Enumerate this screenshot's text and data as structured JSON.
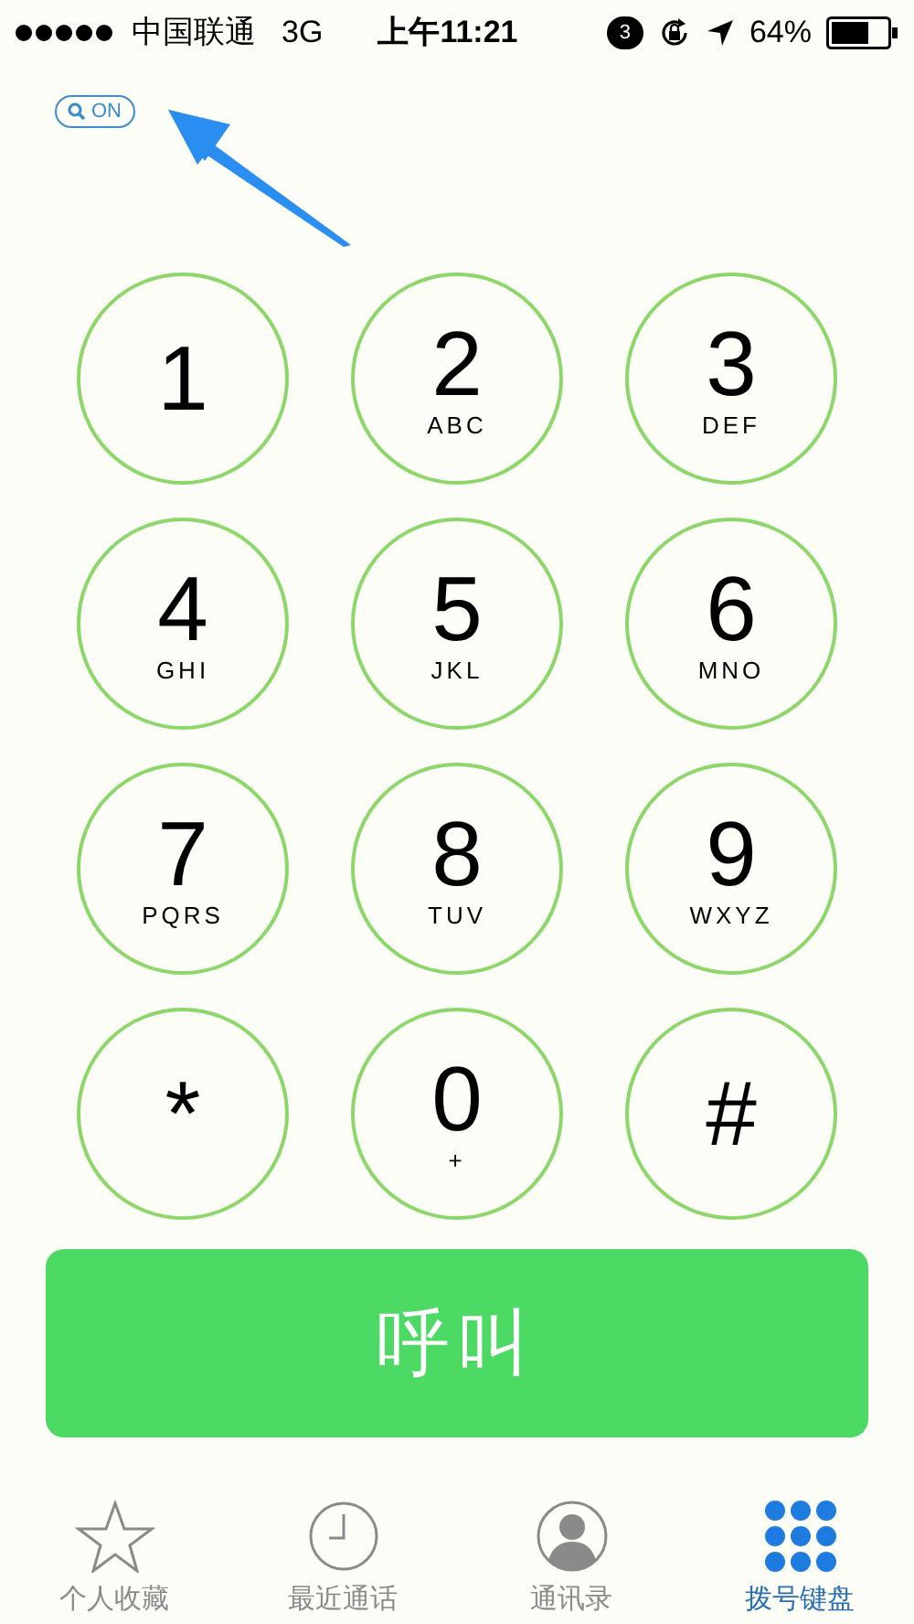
{
  "status_bar": {
    "carrier": "中国联通",
    "network": "3G",
    "time": "上午11:21",
    "notification_count": "3",
    "battery": "64%"
  },
  "search_badge": {
    "label": "ON"
  },
  "keypad": [
    {
      "digit": "1"
    },
    {
      "digit": "2",
      "letters": "ABC"
    },
    {
      "digit": "3",
      "letters": "DEF"
    },
    {
      "digit": "4",
      "letters": "GHI"
    },
    {
      "digit": "5",
      "letters": "JKL"
    },
    {
      "digit": "6",
      "letters": "MNO"
    },
    {
      "digit": "7",
      "letters": "PQRS"
    },
    {
      "digit": "8",
      "letters": "TUV"
    },
    {
      "digit": "9",
      "letters": "WXYZ"
    },
    {
      "digit": "*"
    },
    {
      "digit": "0",
      "letters": "+"
    },
    {
      "digit": "#"
    }
  ],
  "call_button": {
    "label": "呼叫"
  },
  "tab_bar": [
    {
      "kind": "star",
      "label": "个人收藏",
      "selected": false
    },
    {
      "kind": "clock",
      "label": "最近通话",
      "selected": false
    },
    {
      "kind": "contact",
      "label": "通讯录",
      "selected": false
    },
    {
      "kind": "keypad",
      "label": "拨号键盘",
      "selected": true
    }
  ]
}
